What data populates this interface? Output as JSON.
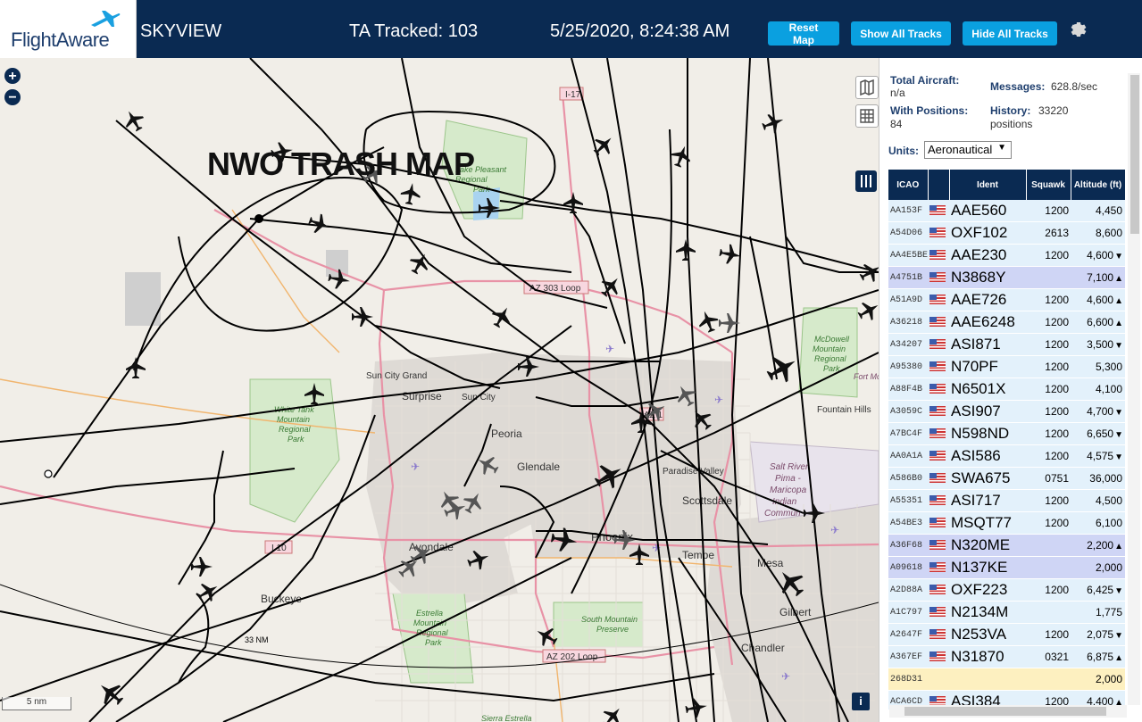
{
  "header": {
    "logo_text": "FlightAware",
    "app_name": "SKYVIEW",
    "tracked": "TA Tracked: 103",
    "datetime": "5/25/2020, 8:24:38 AM",
    "buttons": {
      "reset": "Reset Map",
      "show_all": "Show All Tracks",
      "hide_all": "Hide All Tracks"
    },
    "gear_icon": "gear-icon"
  },
  "map": {
    "overlay_title": "NWO TRASH MAP",
    "zoom_in": "+",
    "zoom_out": "−",
    "scale_label": "5 nm",
    "range_ring_label": "33 NM",
    "info_label": "i",
    "colors": {
      "land": "#f1eee8",
      "water": "#a9d3f0",
      "park": "#d6eacb",
      "track": "#000000",
      "urban": "#dedad5",
      "road": "#e892a6"
    },
    "place_labels": [
      "Lake Pleasant Regional Park",
      "Sun City Grand",
      "Surprise",
      "Sun City",
      "Peoria",
      "Glendale",
      "Paradise Valley",
      "Scottsdale",
      "Phoenix",
      "Tempe",
      "Mesa",
      "Avondale",
      "Buckeye",
      "Gilbert",
      "Chandler",
      "Fountain Hills",
      "McDowell Mountain Regional Park",
      "White Tank Mountain Regional Park",
      "Estrella Mountain Regional Park",
      "South Mountain Preserve",
      "Salt River Pima - Maricopa Indian Commun",
      "Sierra Estrella",
      "Fort Mc"
    ],
    "road_labels": [
      "I-17",
      "AZ 303 Loop",
      "I 10",
      "AZ 202 Loop",
      "AZ 1"
    ]
  },
  "panel": {
    "stats": {
      "total_aircraft_label": "Total Aircraft:",
      "total_aircraft_value": "n/a",
      "messages_label": "Messages:",
      "messages_value": "628.8/sec",
      "with_positions_label": "With Positions:",
      "with_positions_value": "84",
      "history_label": "History:",
      "history_value": "33220",
      "history_unit": "positions"
    },
    "units_label": "Units:",
    "units_value": "Aeronautical",
    "table": {
      "headers": [
        "ICAO",
        "",
        "Ident",
        "Squawk",
        "Altitude (ft)"
      ],
      "rows": [
        {
          "icao": "AA153F",
          "ident": "AAE560",
          "squawk": "1200",
          "alt": "4,450",
          "trend": "",
          "style": "row"
        },
        {
          "icao": "A54D06",
          "ident": "OXF102",
          "squawk": "2613",
          "alt": "8,600",
          "trend": "",
          "style": "row"
        },
        {
          "icao": "AA4E5BE",
          "ident": "AAE230",
          "squawk": "1200",
          "alt": "4,600",
          "trend": "▼",
          "style": "row"
        },
        {
          "icao": "A4751B",
          "ident": "N3868Y",
          "squawk": "",
          "alt": "7,100",
          "trend": "▲",
          "style": "sel"
        },
        {
          "icao": "A51A9D",
          "ident": "AAE726",
          "squawk": "1200",
          "alt": "4,600",
          "trend": "▲",
          "style": "row"
        },
        {
          "icao": "A36218",
          "ident": "AAE6248",
          "squawk": "1200",
          "alt": "6,600",
          "trend": "▲",
          "style": "row"
        },
        {
          "icao": "A34207",
          "ident": "ASI871",
          "squawk": "1200",
          "alt": "3,500",
          "trend": "▼",
          "style": "row"
        },
        {
          "icao": "A95380",
          "ident": "N70PF",
          "squawk": "1200",
          "alt": "5,300",
          "trend": "",
          "style": "row"
        },
        {
          "icao": "A88F4B",
          "ident": "N6501X",
          "squawk": "1200",
          "alt": "4,100",
          "trend": "",
          "style": "row"
        },
        {
          "icao": "A3059C",
          "ident": "ASI907",
          "squawk": "1200",
          "alt": "4,700",
          "trend": "▼",
          "style": "row"
        },
        {
          "icao": "A7BC4F",
          "ident": "N598ND",
          "squawk": "1200",
          "alt": "6,650",
          "trend": "▼",
          "style": "row"
        },
        {
          "icao": "AA0A1A",
          "ident": "ASI586",
          "squawk": "1200",
          "alt": "4,575",
          "trend": "▼",
          "style": "row"
        },
        {
          "icao": "A586B0",
          "ident": "SWA675",
          "squawk": "0751",
          "alt": "36,000",
          "trend": "",
          "style": "row"
        },
        {
          "icao": "A55351",
          "ident": "ASI717",
          "squawk": "1200",
          "alt": "4,500",
          "trend": "",
          "style": "row"
        },
        {
          "icao": "A54BE3",
          "ident": "MSQT77",
          "squawk": "1200",
          "alt": "6,100",
          "trend": "",
          "style": "row"
        },
        {
          "icao": "A36F68",
          "ident": "N320ME",
          "squawk": "",
          "alt": "2,200",
          "trend": "▲",
          "style": "sel"
        },
        {
          "icao": "A09618",
          "ident": "N137KE",
          "squawk": "",
          "alt": "2,000",
          "trend": "",
          "style": "sel"
        },
        {
          "icao": "A2D88A",
          "ident": "OXF223",
          "squawk": "1200",
          "alt": "6,425",
          "trend": "▼",
          "style": "row"
        },
        {
          "icao": "A1C797",
          "ident": "N2134M",
          "squawk": "",
          "alt": "1,775",
          "trend": "",
          "style": "row"
        },
        {
          "icao": "A2647F",
          "ident": "N253VA",
          "squawk": "1200",
          "alt": "2,075",
          "trend": "▼",
          "style": "row"
        },
        {
          "icao": "A367EF",
          "ident": "N31870",
          "squawk": "0321",
          "alt": "6,875",
          "trend": "▲",
          "style": "row"
        },
        {
          "icao": "268D31",
          "ident": "",
          "squawk": "",
          "alt": "2,000",
          "trend": "",
          "style": "yel"
        },
        {
          "icao": "ACA6CD",
          "ident": "ASI384",
          "squawk": "1200",
          "alt": "4,400",
          "trend": "▲",
          "style": "row"
        }
      ]
    }
  }
}
